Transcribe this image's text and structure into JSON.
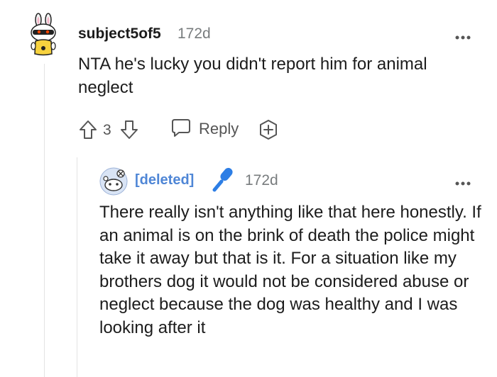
{
  "comment": {
    "username": "subject5of5",
    "time": "172d",
    "body": "NTA he's lucky you didn't report him for animal neglect",
    "votes": "3",
    "reply_label": "Reply"
  },
  "reply": {
    "username": "[deleted]",
    "time": "172d",
    "body": "There really isn't anything like that here honestly. If an animal is on the brink of death the police might take it away but that is it. For a situation like my brothers dog it would not be considered abuse or neglect because the dog was healthy and I was looking after it"
  },
  "colors": {
    "deleted_user": "#4f86d6",
    "muted": "#787c7e",
    "mic_icon": "#2d7ee5"
  },
  "icons": [
    "snoo-avatar-icon",
    "more-options-icon",
    "upvote-icon",
    "downvote-icon",
    "reply-bubble-icon",
    "add-award-icon",
    "deleted-avatar-icon",
    "microphone-icon"
  ]
}
